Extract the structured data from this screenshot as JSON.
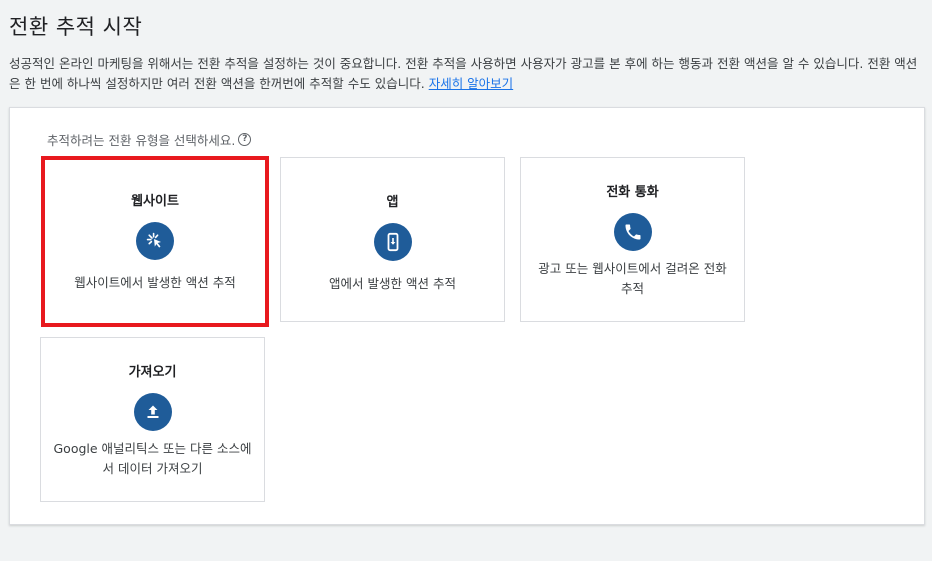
{
  "page": {
    "title": "전환 추적 시작",
    "intro": "성공적인 온라인 마케팅을 위해서는 전환 추적을 설정하는 것이 중요합니다. 전환 추적을 사용하면 사용자가 광고를 본 후에 하는 행동과 전환 액션을 알 수 있습니다. 전환 액션은 한 번에 하나씩 설정하지만 여러 전환 액션을 한꺼번에 추적할 수도 있습니다.",
    "learn_more": "자세히 알아보기"
  },
  "panel": {
    "prompt": "추적하려는 전환 유형을 선택하세요.",
    "help_glyph": "?"
  },
  "cards": {
    "website": {
      "title": "웹사이트",
      "desc": "웹사이트에서 발생한 액션 추적",
      "icon": "cursor-click-icon",
      "selected": true
    },
    "app": {
      "title": "앱",
      "desc": "앱에서 발생한 액션 추적",
      "icon": "phone-download-icon"
    },
    "call": {
      "title": "전화 통화",
      "desc": "광고 또는 웹사이트에서 걸려온 전화 추적",
      "icon": "phone-call-icon"
    },
    "import": {
      "title": "가져오기",
      "desc": "Google 애널리틱스 또는 다른 소스에서 데이터 가져오기",
      "icon": "upload-icon"
    }
  },
  "colors": {
    "accent": "#1f5c99",
    "selection_border": "#e8191e",
    "link": "#1a73e8"
  }
}
